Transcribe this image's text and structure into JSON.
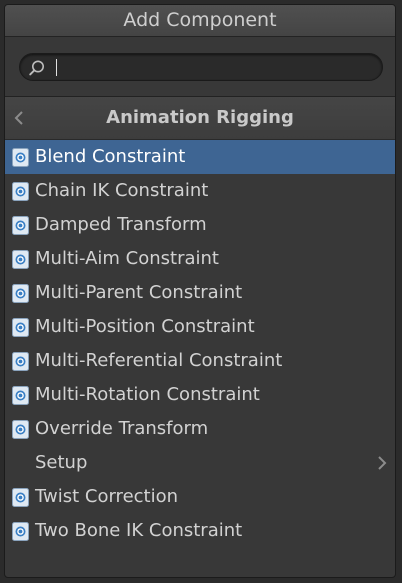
{
  "window": {
    "title": "Add Component"
  },
  "search": {
    "value": "",
    "placeholder": ""
  },
  "category": {
    "title": "Animation Rigging"
  },
  "items": [
    {
      "label": "Blend Constraint",
      "icon": "script-icon",
      "selected": true
    },
    {
      "label": "Chain IK Constraint",
      "icon": "script-icon"
    },
    {
      "label": "Damped Transform",
      "icon": "script-icon"
    },
    {
      "label": "Multi-Aim Constraint",
      "icon": "script-icon"
    },
    {
      "label": "Multi-Parent Constraint",
      "icon": "script-icon"
    },
    {
      "label": "Multi-Position Constraint",
      "icon": "script-icon"
    },
    {
      "label": "Multi-Referential Constraint",
      "icon": "script-icon"
    },
    {
      "label": "Multi-Rotation Constraint",
      "icon": "script-icon"
    },
    {
      "label": "Override Transform",
      "icon": "script-icon"
    },
    {
      "label": "Setup",
      "icon": "",
      "submenu": true
    },
    {
      "label": "Twist Correction",
      "icon": "script-icon"
    },
    {
      "label": "Two Bone IK Constraint",
      "icon": "script-icon"
    }
  ],
  "colors": {
    "selection": "#3e6593",
    "panel": "#383838",
    "text": "#d2d2d2"
  }
}
